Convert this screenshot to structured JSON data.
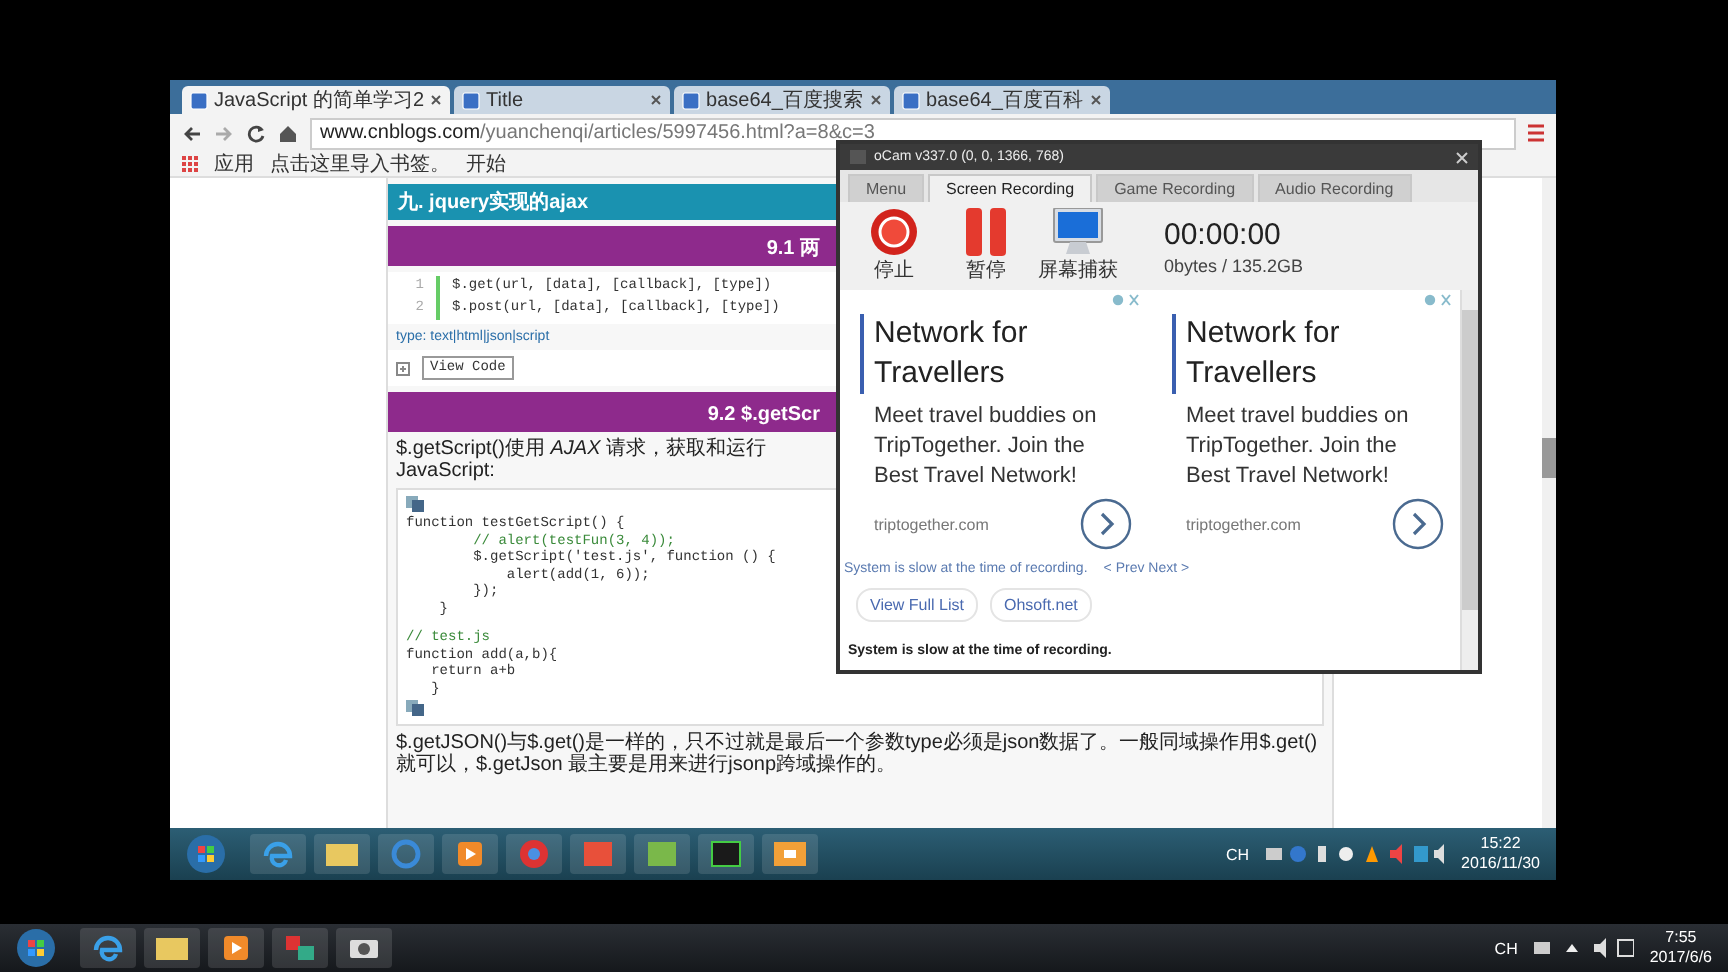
{
  "browser": {
    "tabs": [
      {
        "title": "JavaScript 的简单学习2",
        "selected": true
      },
      {
        "title": "Title",
        "selected": false
      },
      {
        "title": "base64_百度搜索",
        "selected": false
      },
      {
        "title": "base64_百度百科",
        "selected": false
      }
    ],
    "address": {
      "host": "www.cnblogs.com",
      "path": "/yuanchenqi/articles/5997456.html?a=8&c=3"
    },
    "bookmarks": [
      "应用",
      "点击这里导入书签。",
      "开始"
    ]
  },
  "article": {
    "blocks": [
      {
        "kind": "heading",
        "text": "九. jquery实现的ajax"
      },
      {
        "kind": "subheading",
        "text": "9.1 两"
      },
      {
        "kind": "numbered_code",
        "lines": [
          {
            "number": "1",
            "text": "$.get(url, [data], [callback], [type])"
          },
          {
            "number": "2",
            "text": "$.post(url, [data], [callback], [type])"
          }
        ]
      },
      {
        "kind": "text",
        "text": "type: text|html|json|script"
      },
      {
        "kind": "toggle",
        "text": "View Code"
      },
      {
        "kind": "subheading",
        "text": "9.2 $.getScr"
      },
      {
        "kind": "paragraph",
        "text": "$.getScript()使用 *AJAX* 请求，获取和运行 JavaScript:"
      },
      {
        "kind": "code",
        "lines": [
          {
            "text": "function testGetScript() {",
            "comment": false
          },
          {
            "text": "        // alert(testFun(3, 4));",
            "comment": true
          },
          {
            "text": "        $.getScript('test.js', function () {",
            "comment": false
          },
          {
            "text": "            alert(add(1, 6));",
            "comment": false
          },
          {
            "text": "        });",
            "comment": false
          },
          {
            "text": "    }",
            "comment": false
          },
          {
            "text": "// test.js",
            "comment": true
          },
          {
            "text": "function add(a,b){",
            "comment": false
          },
          {
            "text": "   return a+b",
            "comment": false
          },
          {
            "text": "   }",
            "comment": false
          }
        ]
      },
      {
        "kind": "paragraph",
        "text": "$.getJSON()与$.get()是一样的，只不过就是最后一个参数type必须是json数据了。一般同域操作用$.get()就可以，$.getJson 最主要是用来进行jsonp跨域操作的。"
      }
    ]
  },
  "ocam": {
    "title": "oCam v337.0 (0, 0, 1366, 768)",
    "tabs": [
      {
        "label": "Menu",
        "selected": false
      },
      {
        "label": "Screen Recording",
        "selected": true
      },
      {
        "label": "Game Recording",
        "selected": false
      },
      {
        "label": "Audio Recording",
        "selected": false
      }
    ],
    "tools": [
      {
        "kind": "stop",
        "label": "停止"
      },
      {
        "kind": "pause",
        "label": "暂停"
      },
      {
        "kind": "capture",
        "label": "屏幕捕获"
      }
    ],
    "timer": "00:00:00",
    "size": "0bytes / 135.2GB",
    "ads": [
      {
        "headline": "Network for Travellers",
        "body": "Meet travel buddies on TripTogether. Join the Best Travel Network!",
        "domain": "triptogether.com"
      },
      {
        "headline": "Network for Travellers",
        "body": "Meet travel buddies on TripTogether. Join the Best Travel Network!",
        "domain": "triptogether.com"
      }
    ],
    "notice": "System is slow at the time of recording.",
    "pager": "< Prev Next >",
    "links": [
      "View Full List",
      "Ohsoft.net"
    ],
    "status": "System is slow at the time of recording."
  },
  "inner_taskbar": {
    "language": "CH",
    "time": "15:22",
    "date": "2016/11/30"
  },
  "outer_taskbar": {
    "language": "CH",
    "time": "7:55",
    "date": "2017/6/6"
  }
}
